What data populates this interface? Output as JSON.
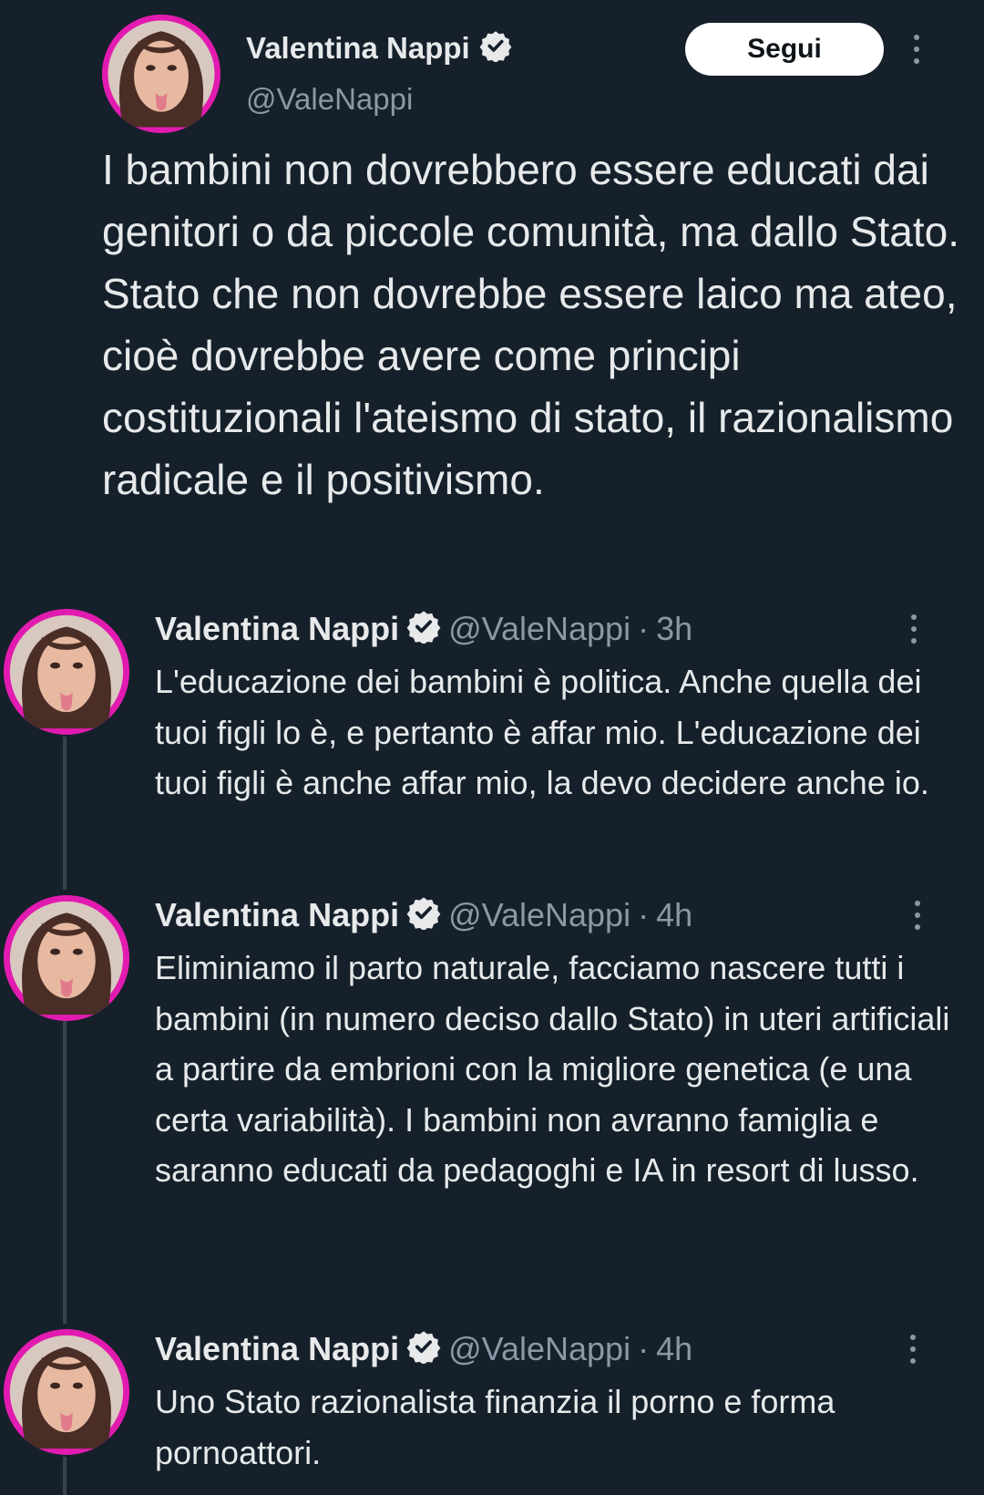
{
  "main_tweet": {
    "author_name": "Valentina Nappi",
    "author_handle": "@ValeNappi",
    "follow_label": "Segui",
    "text": "I bambini non dovrebbero essere educati dai genitori o da piccole comunità, ma dallo Stato. Stato che non dovrebbe essere laico ma ateo, cioè dovrebbe avere come principi costituzionali l'ateismo di stato, il razionalismo radicale e il positivismo."
  },
  "replies": [
    {
      "author_name": "Valentina Nappi",
      "author_handle": "@ValeNappi",
      "separator": "·",
      "time": "3h",
      "text": "L'educazione dei bambini è politica. Anche quella dei tuoi figli lo è, e pertanto è affar mio. L'educazione dei tuoi figli è anche affar mio, la devo decidere anche io."
    },
    {
      "author_name": "Valentina Nappi",
      "author_handle": "@ValeNappi",
      "separator": "·",
      "time": "4h",
      "text": "Eliminiamo il parto naturale, facciamo nascere tutti i bambini (in numero deciso dallo Stato) in uteri artificiali a partire da embrioni con la migliore genetica (e una certa variabilità). I bambini non avranno famiglia e saranno educati da pedagoghi e IA in resort di lusso."
    },
    {
      "author_name": "Valentina Nappi",
      "author_handle": "@ValeNappi",
      "separator": "·",
      "time": "4h",
      "text": "Uno Stato razionalista finanzia il porno e forma pornoattori."
    }
  ],
  "icons": {
    "verified": "verified-badge-icon",
    "more": "more-options-icon",
    "avatar": "avatar"
  },
  "colors": {
    "background": "#15202b",
    "text": "#e7e9ea",
    "secondary_text": "#8b98a5",
    "avatar_ring": "#e21bb0",
    "follow_button_bg": "#ffffff"
  }
}
